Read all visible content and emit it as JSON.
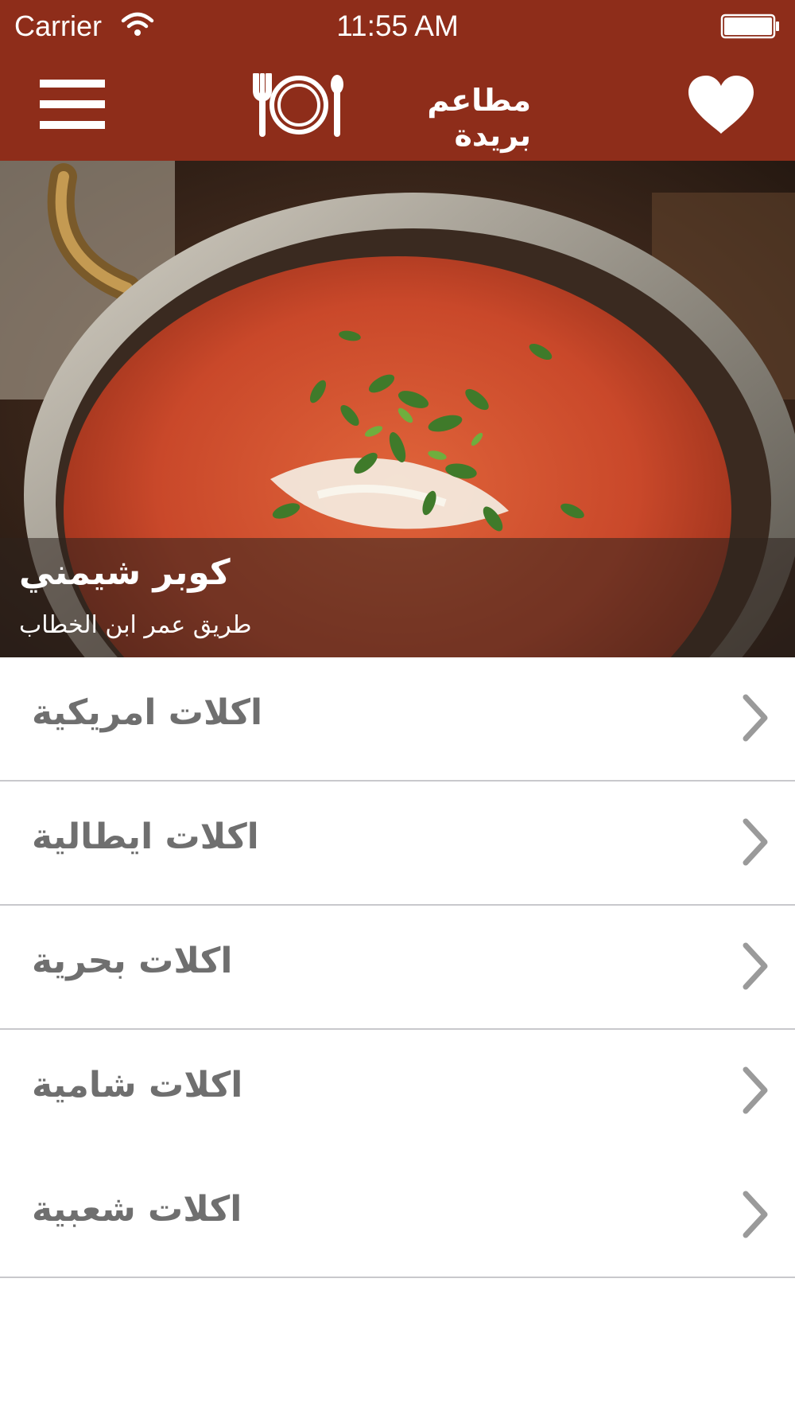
{
  "status_bar": {
    "carrier": "Carrier",
    "time": "11:55 AM"
  },
  "header": {
    "title": "مطاعم بريدة",
    "menu_icon": "hamburger-menu-icon",
    "logo_icon": "plate-fork-spoon-icon",
    "favorite_icon": "heart-icon",
    "background_color": "#8e2d1a"
  },
  "hero": {
    "name": "كوبر شيمني",
    "address": "طريق عمر ابن الخطاب"
  },
  "categories": [
    {
      "label": "اكلات امريكية"
    },
    {
      "label": "اكلات ايطالية"
    },
    {
      "label": "اكلات بحرية"
    },
    {
      "label": "اكلات شامية"
    },
    {
      "label": "اكلات شعبية"
    }
  ]
}
